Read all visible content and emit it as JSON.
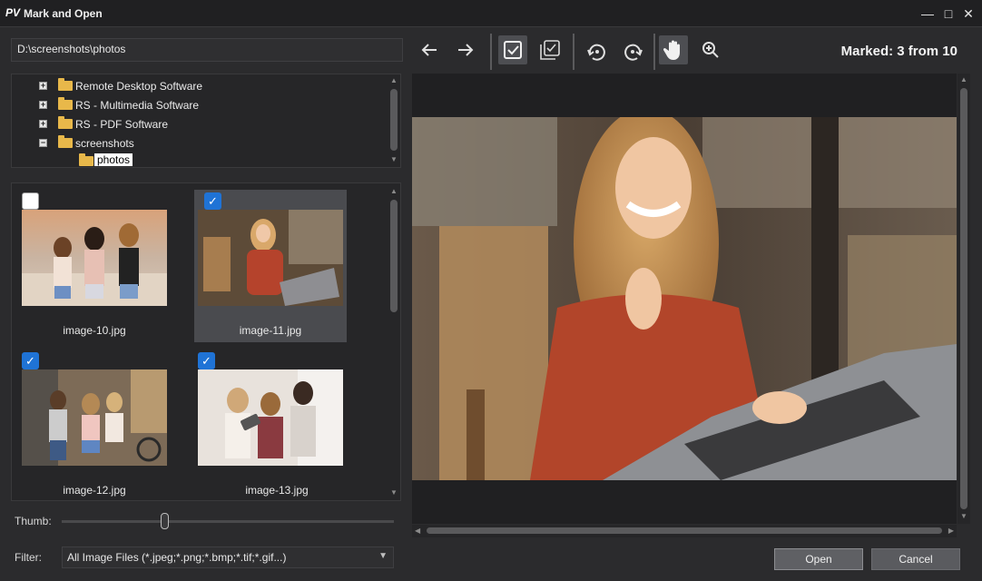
{
  "window": {
    "title": "Mark and Open",
    "logo": "PV"
  },
  "path": "D:\\screenshots\\photos",
  "tree": {
    "items": [
      {
        "label": "Remote Desktop Software",
        "expander": "+"
      },
      {
        "label": "RS - Multimedia Software",
        "expander": "+"
      },
      {
        "label": "RS - PDF Software",
        "expander": "+"
      },
      {
        "label": "screenshots",
        "expander": "−"
      },
      {
        "label": "photos",
        "expander": ""
      }
    ]
  },
  "thumbnails": [
    {
      "name": "image-10.jpg",
      "checked": false
    },
    {
      "name": "image-11.jpg",
      "checked": true
    },
    {
      "name": "image-12.jpg",
      "checked": true
    },
    {
      "name": "image-13.jpg",
      "checked": true
    }
  ],
  "thumb_label": "Thumb:",
  "thumb_size_fraction": 0.31,
  "filter": {
    "label": "Filter:",
    "value": "All Image Files (*.jpeg;*.png;*.bmp;*.tif;*.gif...)"
  },
  "status": {
    "marked": "Marked: 3 from 10"
  },
  "buttons": {
    "open": "Open",
    "cancel": "Cancel"
  },
  "icons": {
    "back": "arrow-left-icon",
    "forward": "arrow-right-icon",
    "mark": "checkbox-checked-icon",
    "mark_all": "checkbox-multiple-icon",
    "rotate_left": "rotate-left-icon",
    "rotate_right": "rotate-right-icon",
    "pan": "hand-icon",
    "zoom": "zoom-in-icon"
  },
  "colors": {
    "accent": "#1f73d6",
    "folder": "#e8b84a",
    "background": "#2b2b2d"
  }
}
